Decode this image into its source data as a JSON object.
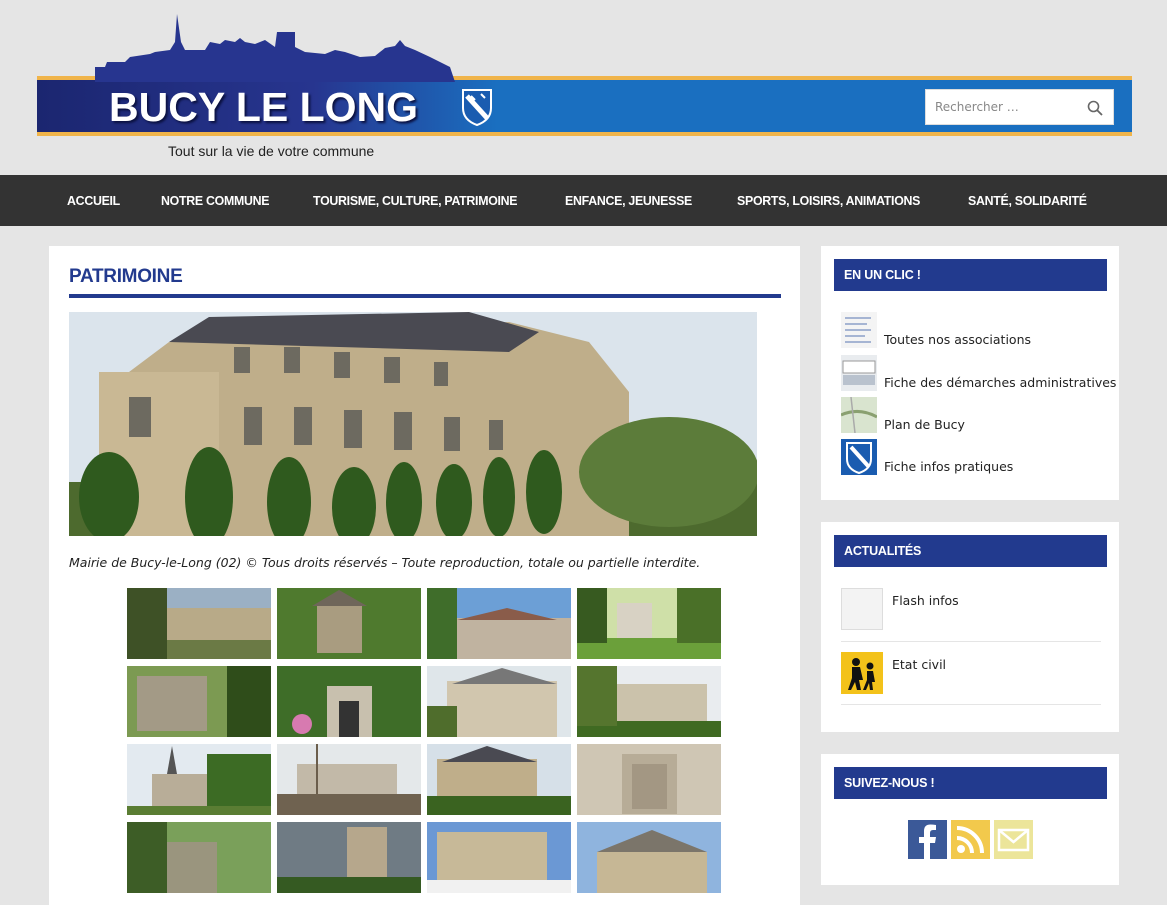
{
  "header": {
    "logo_title": "BUCY LE LONG",
    "tagline": "Tout sur la vie de votre commune",
    "search_placeholder": "Rechercher …",
    "colors": {
      "banner_blue": "#1a6fc0",
      "banner_dark": "#1b2670",
      "accent_gold": "#f0b44a"
    }
  },
  "nav": {
    "items": [
      "Accueil",
      "Notre commune",
      "Tourisme, culture, patrimoine",
      "Enfance, jeunesse",
      "Sports, loisirs, animations",
      "Santé, solidarité"
    ]
  },
  "main": {
    "title": "PATRIMOINE",
    "hero_caption": "Mairie de Bucy-le-Long (02) © Tous droits réservés – Toute reproduction, totale ou partielle interdite.",
    "accent_color": "#223a8e"
  },
  "sidebar": {
    "en_un_clic": {
      "title": "EN UN CLIC !",
      "items": [
        {
          "label": "Toutes nos associations"
        },
        {
          "label": "Fiche des démarches administratives"
        },
        {
          "label": "Plan de Bucy"
        },
        {
          "label": "Fiche infos pratiques"
        }
      ]
    },
    "actualites": {
      "title": "ACTUALITÉS",
      "items": [
        {
          "label": "Flash infos"
        },
        {
          "label": "Etat civil"
        }
      ]
    },
    "suivez_nous": {
      "title": "SUIVEZ-NOUS !",
      "icons": [
        "facebook-icon",
        "rss-icon",
        "email-icon"
      ]
    }
  }
}
